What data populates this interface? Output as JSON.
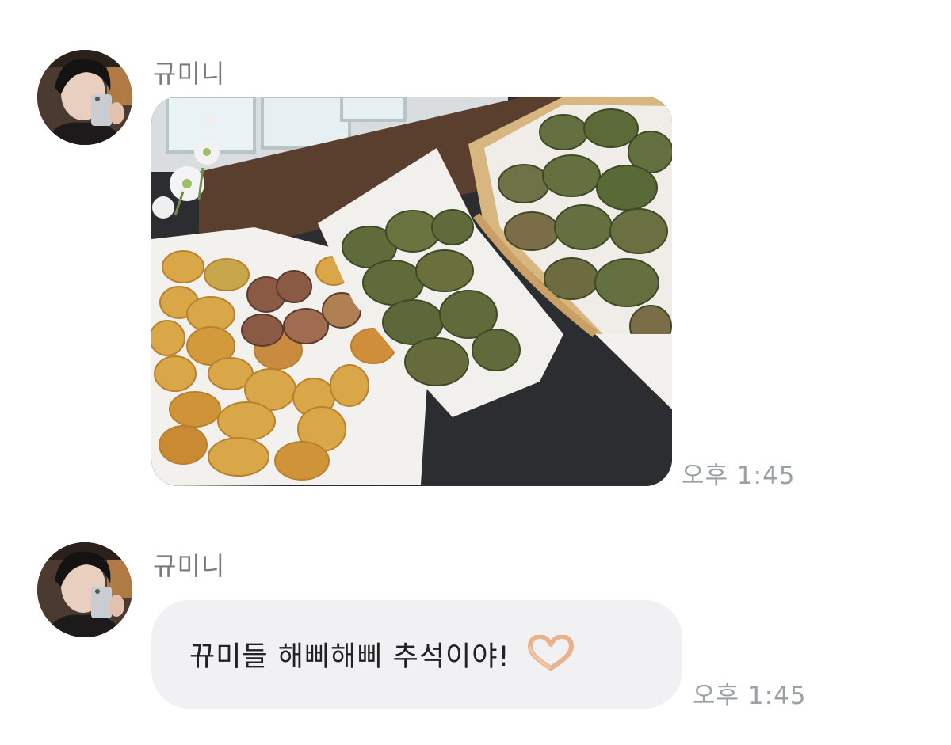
{
  "messages": [
    {
      "sender": "규미니",
      "type": "image",
      "image_alt": "photo of fried jeon pancakes on trays",
      "time": "오후 1:45"
    },
    {
      "sender": "규미니",
      "type": "text",
      "text": "뀨미들 해삐해삐 추석이야!",
      "emoji": "hand-heart-emoji",
      "time": "오후 1:45"
    }
  ],
  "colors": {
    "bubble_bg": "#f1f1f3",
    "time_text": "#9aa0a6",
    "sender_text": "#777b80"
  }
}
